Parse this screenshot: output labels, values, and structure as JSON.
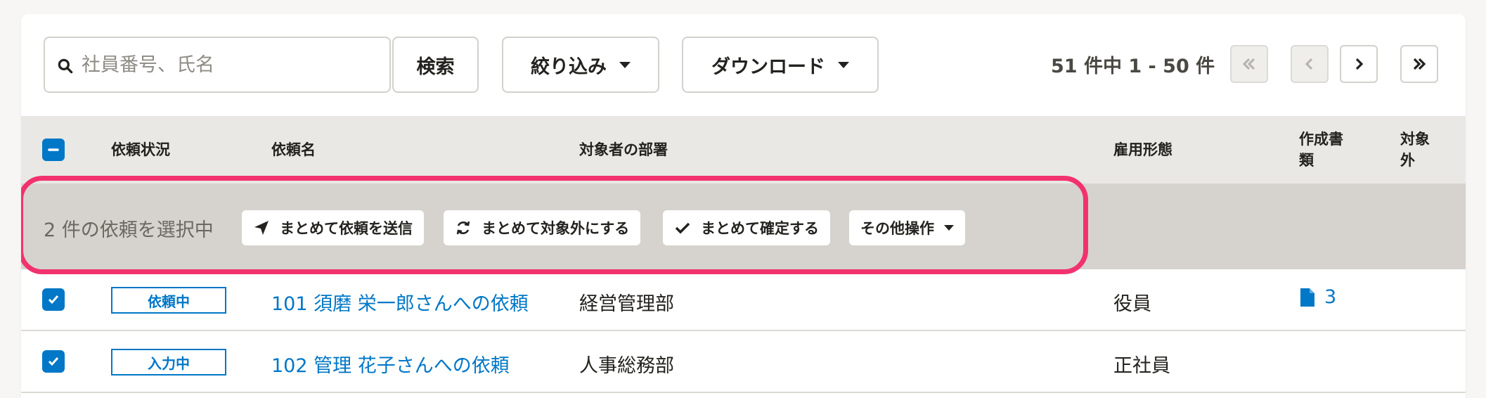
{
  "toolbar": {
    "search_placeholder": "社員番号、氏名",
    "search_label": "検索",
    "filter_label": "絞り込み",
    "download_label": "ダウンロード",
    "page_info": "51 件中 1 - 50 件"
  },
  "table": {
    "columns": [
      "依頼状況",
      "依頼名",
      "対象者の部署",
      "雇用形態",
      "作成書\n類",
      "対象\n外"
    ],
    "rows": [
      {
        "status": "依頼中",
        "name": "101 須磨 栄一郎さんへの依頼",
        "department": "経営管理部",
        "employment": "役員",
        "docs": "3",
        "checked": true
      },
      {
        "status": "入力中",
        "name": "102 管理 花子さんへの依頼",
        "department": "人事総務部",
        "employment": "正社員",
        "docs": "",
        "checked": true
      }
    ]
  },
  "selection": {
    "text": "2 件の依頼を選択中",
    "actions": [
      "まとめて依頼を送信",
      "まとめて対象外にする",
      "まとめて確定する",
      "その他操作"
    ]
  },
  "colors": {
    "primary": "#0077c7",
    "highlight": "#f2326f"
  },
  "icons": [
    "search-icon",
    "send-icon",
    "refresh-icon",
    "check-icon",
    "document-icon"
  ]
}
